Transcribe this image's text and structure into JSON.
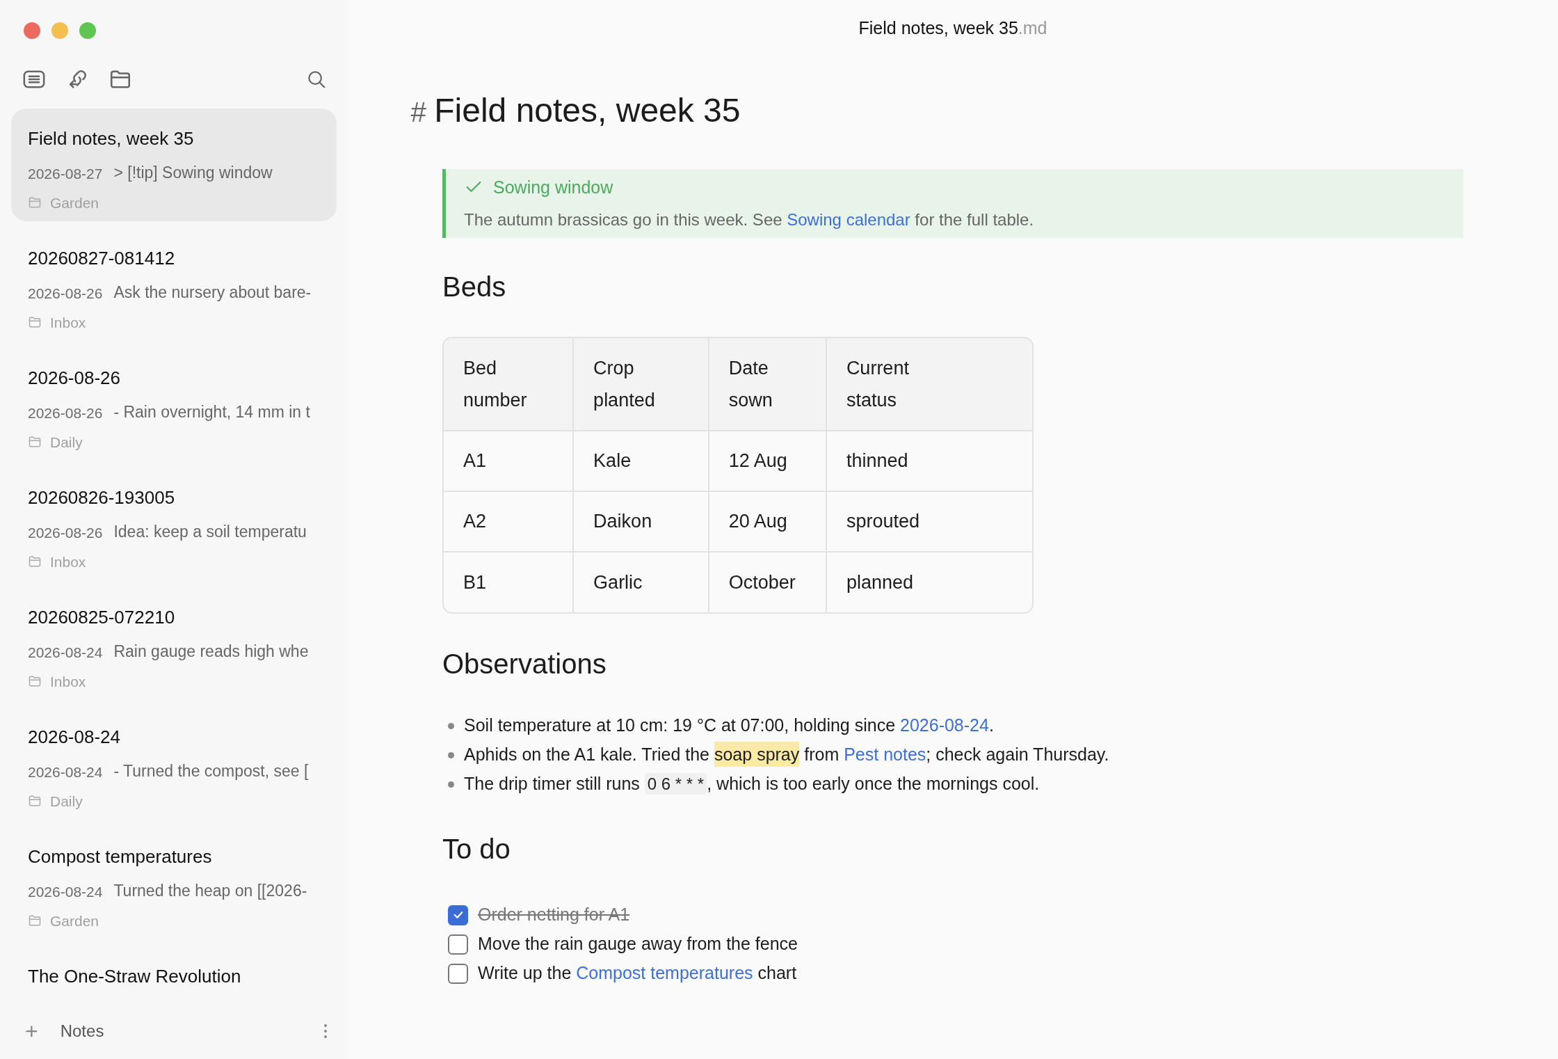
{
  "window": {
    "title": "Field notes, week 35",
    "extension": ".md"
  },
  "sidebar": {
    "notes": [
      {
        "title": "Field notes, week 35",
        "date": "2026-08-27",
        "preview": "> [!tip] Sowing window",
        "folder": "Garden",
        "selected": true
      },
      {
        "title": "20260827-081412",
        "date": "2026-08-26",
        "preview": "Ask the nursery about bare-",
        "folder": "Inbox",
        "selected": false
      },
      {
        "title": "2026-08-26",
        "date": "2026-08-26",
        "preview": "- Rain overnight, 14 mm in t",
        "folder": "Daily",
        "selected": false
      },
      {
        "title": "20260826-193005",
        "date": "2026-08-26",
        "preview": "Idea: keep a soil temperatu",
        "folder": "Inbox",
        "selected": false
      },
      {
        "title": "20260825-072210",
        "date": "2026-08-24",
        "preview": "Rain gauge reads high whe",
        "folder": "Inbox",
        "selected": false
      },
      {
        "title": "2026-08-24",
        "date": "2026-08-24",
        "preview": "- Turned the compost, see [",
        "folder": "Daily",
        "selected": false
      },
      {
        "title": "Compost temperatures",
        "date": "2026-08-24",
        "preview": "Turned the heap on [[2026-",
        "folder": "Garden",
        "selected": false
      },
      {
        "title": "The One-Straw Revolution",
        "selected": false
      }
    ],
    "footer": {
      "plus": "+",
      "label": "Notes"
    }
  },
  "document": {
    "heading_mark": "#",
    "title": "Field notes, week 35",
    "callout": {
      "title": "Sowing window",
      "body": [
        {
          "kind": "text",
          "text": "The autumn brassicas go in this week. See "
        },
        {
          "kind": "link",
          "text": "Sowing calendar"
        },
        {
          "kind": "text",
          "text": " for the full table."
        }
      ]
    },
    "sections": [
      {
        "heading": "Beds",
        "kind": "table",
        "table": {
          "columns": [
            "Bed number",
            "Crop planted",
            "Date sown",
            "Current status"
          ],
          "rows": [
            [
              "A1",
              "Kale",
              "12 Aug",
              "thinned"
            ],
            [
              "A2",
              "Daikon",
              "20 Aug",
              "sprouted"
            ],
            [
              "B1",
              "Garlic",
              "October",
              "planned"
            ]
          ]
        }
      },
      {
        "heading": "Observations",
        "kind": "bullets",
        "items": [
          [
            {
              "kind": "text",
              "text": "Soil temperature at 10 cm: 19 °C at 07:00, holding since "
            },
            {
              "kind": "link",
              "text": "2026-08-24"
            },
            {
              "kind": "text",
              "text": "."
            }
          ],
          [
            {
              "kind": "text",
              "text": "Aphids on the A1 kale. Tried the "
            },
            {
              "kind": "highlight",
              "text": "soap spray"
            },
            {
              "kind": "text",
              "text": " from "
            },
            {
              "kind": "link",
              "text": "Pest notes"
            },
            {
              "kind": "text",
              "text": "; check again Thursday."
            }
          ],
          [
            {
              "kind": "text",
              "text": "The drip timer still runs "
            },
            {
              "kind": "code",
              "text": "0 6 * * *"
            },
            {
              "kind": "text",
              "text": ", which is too early once the mornings cool."
            }
          ]
        ]
      },
      {
        "heading": "To do",
        "kind": "tasks",
        "items": [
          {
            "checked": true,
            "parts": [
              {
                "kind": "text",
                "text": "Order netting for A1"
              }
            ]
          },
          {
            "checked": false,
            "parts": [
              {
                "kind": "text",
                "text": "Move the rain gauge away from the fence"
              }
            ]
          },
          {
            "checked": false,
            "parts": [
              {
                "kind": "text",
                "text": "Write up the "
              },
              {
                "kind": "link",
                "text": "Compost temperatures"
              },
              {
                "kind": "text",
                "text": " chart"
              }
            ]
          }
        ]
      }
    ]
  }
}
